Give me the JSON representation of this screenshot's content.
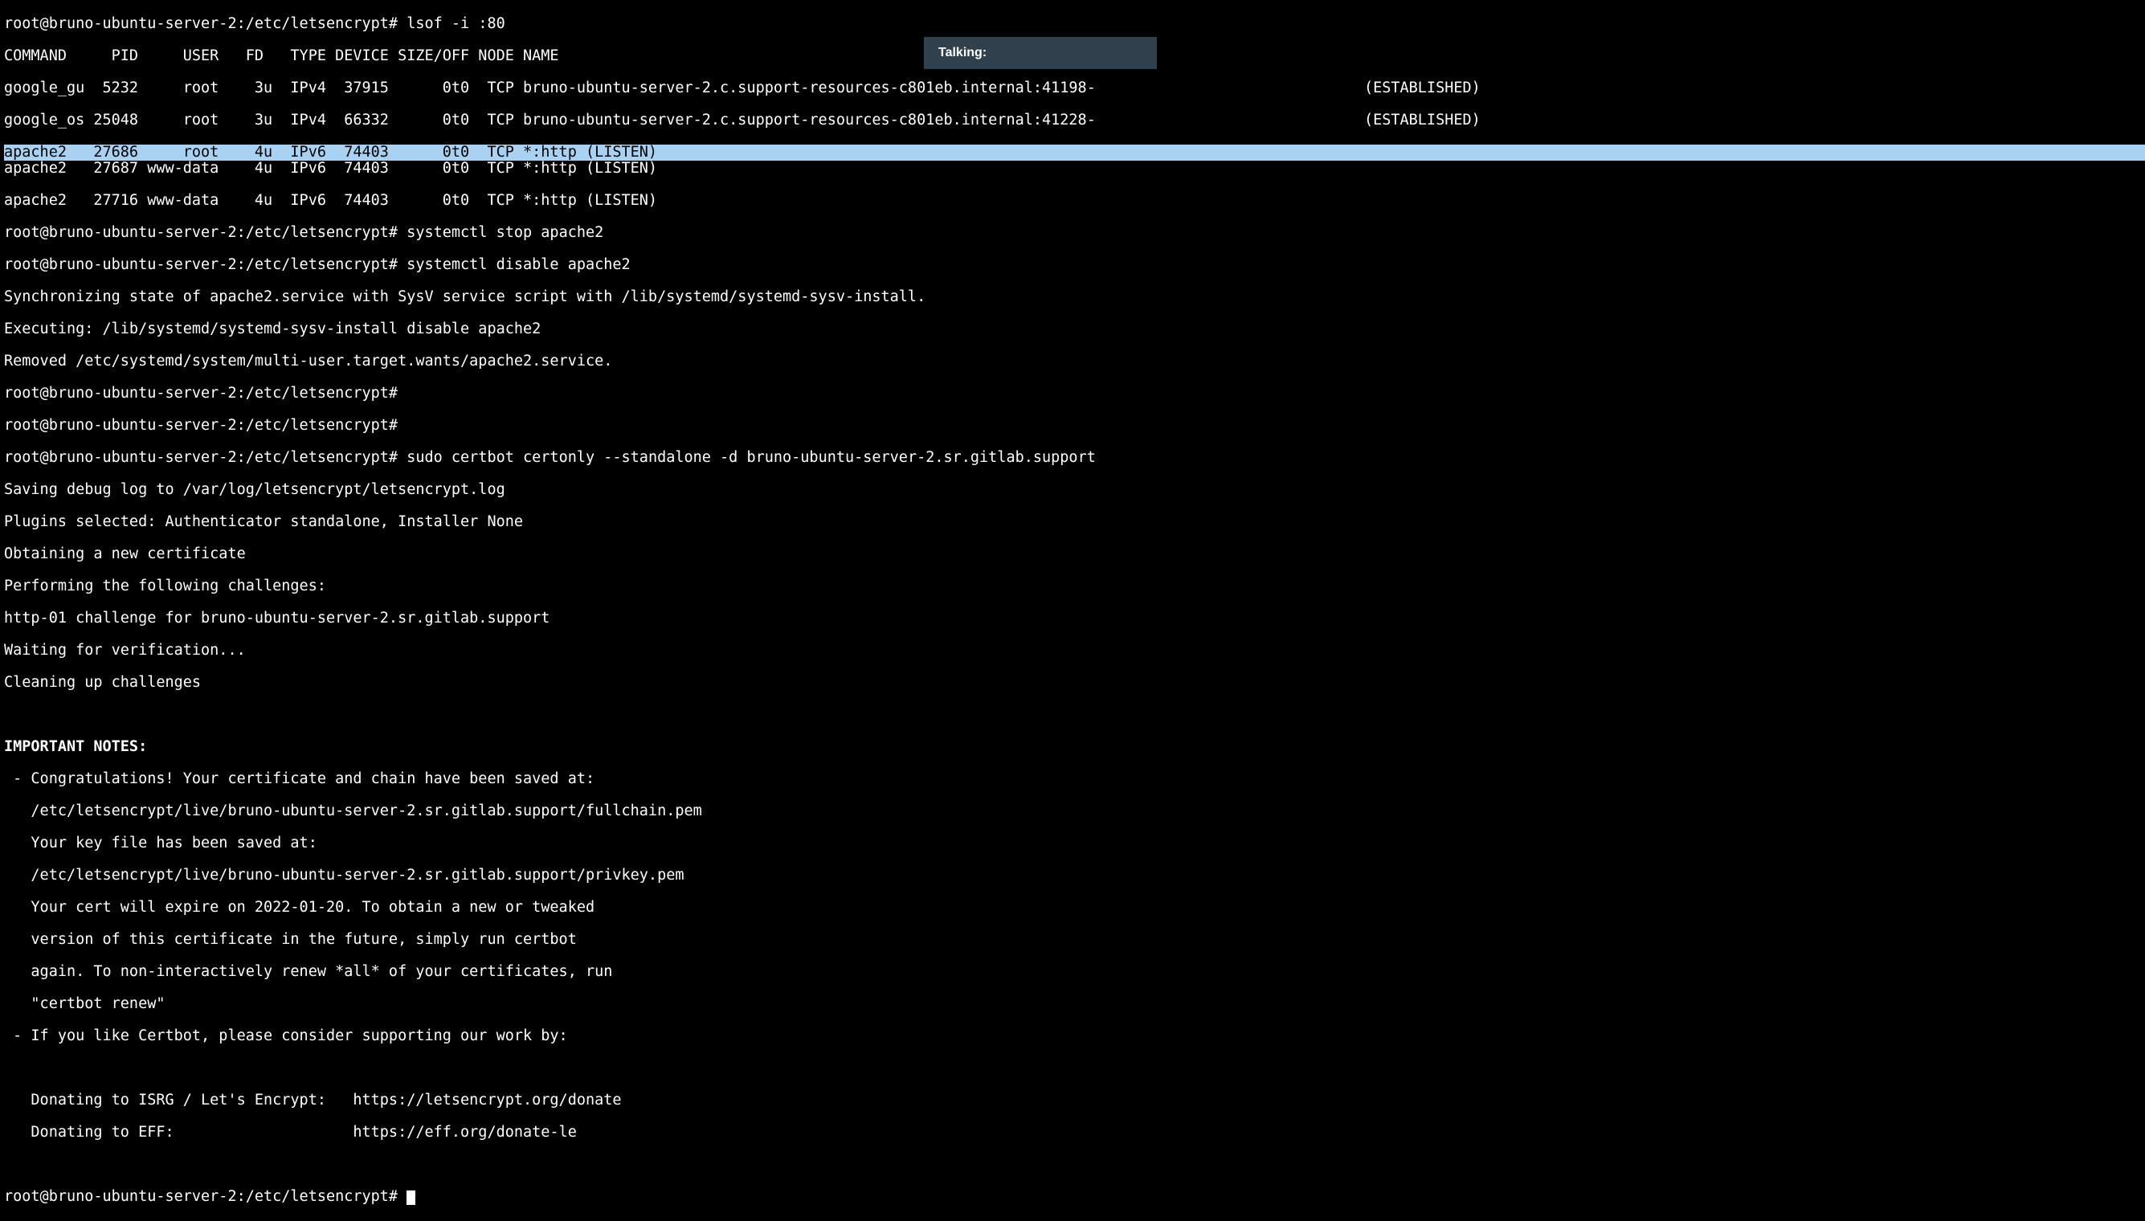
{
  "notif": {
    "label": "Talking:"
  },
  "prompt": "root@bruno-ubuntu-server-2:/etc/letsencrypt#",
  "cmd": {
    "lsof": "lsof -i :80",
    "stop": "systemctl stop apache2",
    "disable": "systemctl disable apache2",
    "certbot": "sudo certbot certonly --standalone -d bruno-ubuntu-server-2.sr.gitlab.support"
  },
  "lsof": {
    "header": "COMMAND     PID     USER   FD   TYPE DEVICE SIZE/OFF NODE NAME",
    "r1": "google_gu  5232     root    3u  IPv4  37915      0t0  TCP bruno-ubuntu-server-2.c.support-resources-c801eb.internal:41198-                              (ESTABLISHED)",
    "r2": "google_os 25048     root    3u  IPv4  66332      0t0  TCP bruno-ubuntu-server-2.c.support-resources-c801eb.internal:41228-                              (ESTABLISHED)",
    "r3": "apache2   27686     root    4u  IPv6  74403      0t0  TCP *:http (LISTEN)",
    "r4": "apache2   27687 www-data    4u  IPv6  74403      0t0  TCP *:http (LISTEN)",
    "r5": "apache2   27716 www-data    4u  IPv6  74403      0t0  TCP *:http (LISTEN)"
  },
  "disable_out": {
    "l1": "Synchronizing state of apache2.service with SysV service script with /lib/systemd/systemd-sysv-install.",
    "l2": "Executing: /lib/systemd/systemd-sysv-install disable apache2",
    "l3": "Removed /etc/systemd/system/multi-user.target.wants/apache2.service."
  },
  "cert": {
    "l1": "Saving debug log to /var/log/letsencrypt/letsencrypt.log",
    "l2": "Plugins selected: Authenticator standalone, Installer None",
    "l3": "Obtaining a new certificate",
    "l4": "Performing the following challenges:",
    "l5": "http-01 challenge for bruno-ubuntu-server-2.sr.gitlab.support",
    "l6": "Waiting for verification...",
    "l7": "Cleaning up challenges"
  },
  "notes": {
    "title": "IMPORTANT NOTES:",
    "n1": " - Congratulations! Your certificate and chain have been saved at:",
    "n2": "   /etc/letsencrypt/live/bruno-ubuntu-server-2.sr.gitlab.support/fullchain.pem",
    "n3": "   Your key file has been saved at:",
    "n4": "   /etc/letsencrypt/live/bruno-ubuntu-server-2.sr.gitlab.support/privkey.pem",
    "n5": "   Your cert will expire on 2022-01-20. To obtain a new or tweaked",
    "n6": "   version of this certificate in the future, simply run certbot",
    "n7": "   again. To non-interactively renew *all* of your certificates, run",
    "n8": "   \"certbot renew\"",
    "n9": " - If you like Certbot, please consider supporting our work by:",
    "n10": "   Donating to ISRG / Let's Encrypt:   https://letsencrypt.org/donate",
    "n11": "   Donating to EFF:                    https://eff.org/donate-le"
  }
}
